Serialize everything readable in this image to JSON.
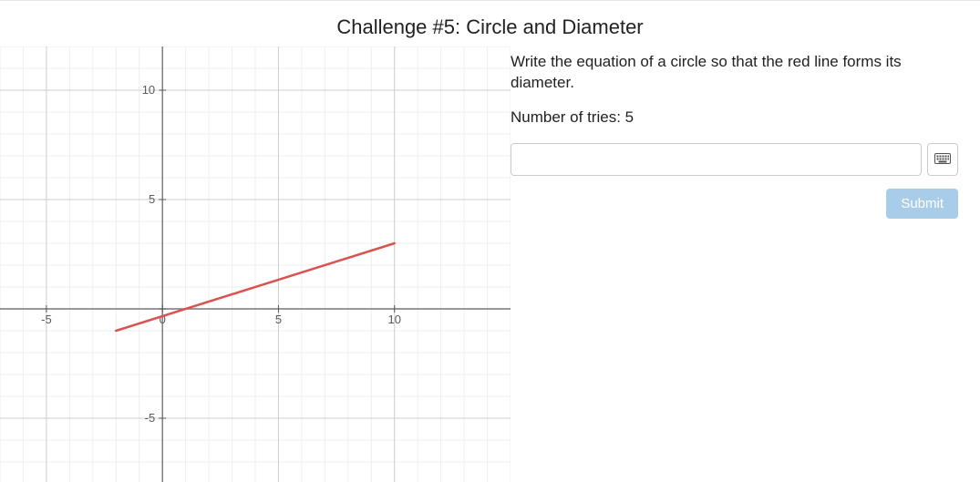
{
  "title": "Challenge #5: Circle and Diameter",
  "prompt": "Write the equation of a circle so that the red line forms its diameter.",
  "tries_label": "Number of tries: ",
  "tries_value": "5",
  "answer_value": "",
  "answer_placeholder": "",
  "submit_label": "Submit",
  "keyboard_icon_name": "keyboard-icon",
  "chart_data": {
    "type": "line",
    "title": "",
    "xlabel": "",
    "ylabel": "",
    "xlim": [
      -7,
      15
    ],
    "ylim": [
      -8,
      12
    ],
    "x_ticks": [
      -5,
      0,
      5,
      10
    ],
    "y_ticks": [
      -5,
      0,
      5,
      10
    ],
    "x_tick_labels": [
      "-5",
      "0",
      "5",
      "10"
    ],
    "y_tick_labels": [
      "-5",
      "0",
      "5",
      "10"
    ],
    "grid": true,
    "series": [
      {
        "name": "red-line",
        "color": "#d9534f",
        "x": [
          -2,
          10
        ],
        "y": [
          -1,
          3
        ]
      }
    ]
  }
}
